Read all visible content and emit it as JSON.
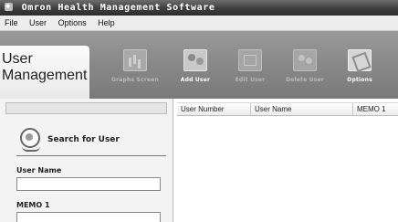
{
  "window": {
    "title": "Omron Health Management Software"
  },
  "menu": {
    "items": [
      "File",
      "User",
      "Options",
      "Help"
    ]
  },
  "mode_tab": {
    "label_line1": "User",
    "label_line2": "Management"
  },
  "toolbar": {
    "buttons": [
      {
        "label": "Graphs Screen",
        "icon": "graphs-icon",
        "enabled": false
      },
      {
        "label": "Add User",
        "icon": "add-user-icon",
        "enabled": true
      },
      {
        "label": "Edit User",
        "icon": "edit-user-icon",
        "enabled": false
      },
      {
        "label": "Delete User",
        "icon": "delete-user-icon",
        "enabled": false
      },
      {
        "label": "Options",
        "icon": "options-icon",
        "enabled": true
      }
    ]
  },
  "search_panel": {
    "search_label": "Search for User",
    "fields": [
      {
        "label": "User Name",
        "value": ""
      },
      {
        "label": "MEMO 1",
        "value": ""
      }
    ]
  },
  "table": {
    "columns": [
      "User Number",
      "User Name",
      "MEMO 1"
    ],
    "rows": []
  },
  "colors": {
    "titlebar": "#3e3e3e",
    "toolbar": "#888888",
    "panel": "#f3f3f3"
  }
}
